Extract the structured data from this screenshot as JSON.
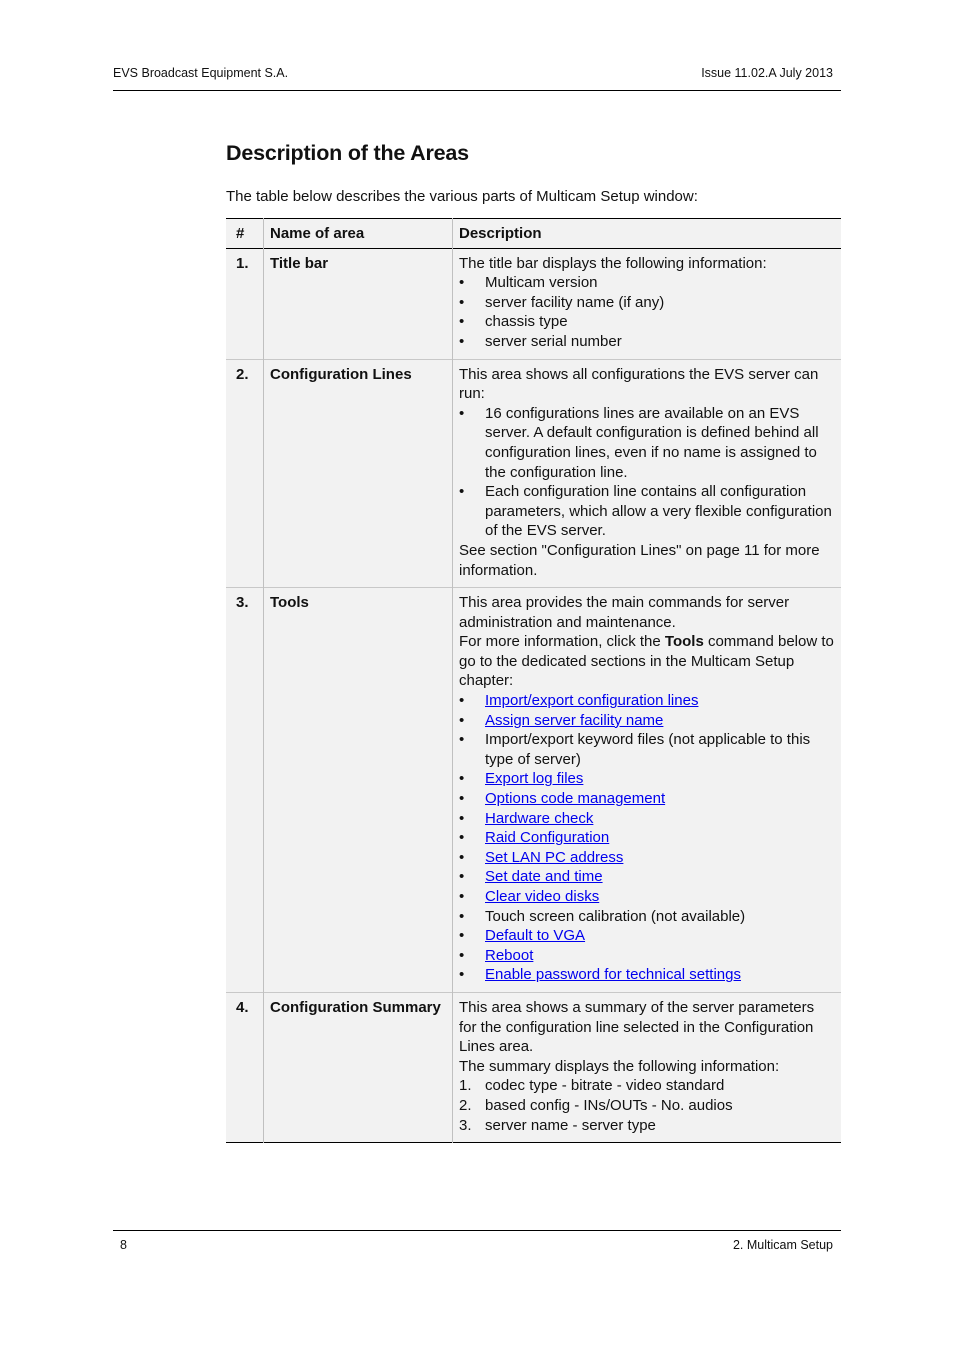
{
  "header": {
    "company": "EVS Broadcast Equipment S.A.",
    "issue": "Issue 11.02.A  July 2013"
  },
  "footer": {
    "page_number": "8",
    "chapter": "2. Multicam Setup"
  },
  "title": "Description of the Areas",
  "intro": "The table below describes the various parts of Multicam Setup window:",
  "table": {
    "headers": [
      "#",
      "Name of area",
      "Description"
    ],
    "rows": [
      {
        "num": "1.",
        "name": "Title bar",
        "intro": "The title bar displays the following information:",
        "bullets": [
          "Multicam version",
          "server facility name (if any)",
          "chassis type",
          "server serial number"
        ]
      },
      {
        "num": "2.",
        "name": "Configuration Lines",
        "intro": "This area shows all configurations the EVS server can run:",
        "bullets": [
          "16 configurations lines are available on an EVS server. A default configuration is defined behind all configuration lines, even if no name is assigned to the configuration line.",
          "Each configuration line contains all configuration parameters, which allow a very flexible configuration of the EVS server."
        ],
        "outro": "See section \"Configuration Lines\" on page 11 for more information."
      },
      {
        "num": "3.",
        "name": "Tools",
        "intro": "This area provides the main commands for server administration and maintenance.",
        "intro2_pre": "For more information, click the ",
        "intro2_bold": "Tools",
        "intro2_post": " command below to go to the dedicated sections in the Multicam Setup chapter:",
        "items": [
          {
            "label": "Import/export configuration lines",
            "link": true
          },
          {
            "label": "Assign server facility name",
            "link": true
          },
          {
            "label": "Import/export keyword files (not applicable to this type of server)",
            "link": false
          },
          {
            "label": "Export log files",
            "link": true
          },
          {
            "label": "Options code management",
            "link": true
          },
          {
            "label": "Hardware check",
            "link": true
          },
          {
            "label": "Raid Configuration",
            "link": true
          },
          {
            "label": "Set LAN PC address",
            "link": true
          },
          {
            "label": "Set date and time",
            "link": true
          },
          {
            "label": "Clear video disks",
            "link": true
          },
          {
            "label": "Touch screen calibration (not available)",
            "link": false
          },
          {
            "label": "Default to VGA",
            "link": true
          },
          {
            "label": "Reboot",
            "link": true
          },
          {
            "label": "Enable password for technical settings",
            "link": true
          }
        ]
      },
      {
        "num": "4.",
        "name": "Configuration Summary",
        "intro": "This area shows a summary of the server parameters for the configuration line selected in the Configuration Lines area.",
        "intro2": "The summary displays the following information:",
        "numbered": [
          "codec type - bitrate - video standard",
          "based config - INs/OUTs - No. audios",
          "server name - server type"
        ]
      }
    ]
  },
  "colors": {
    "link": "#0000ee",
    "table_bg": "#f2f2f2"
  }
}
